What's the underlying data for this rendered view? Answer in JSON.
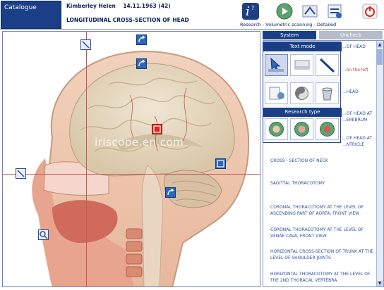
{
  "header": {
    "catalogue_label": "Catalogue",
    "patient_name": "Kimberley Helen",
    "patient_birthdate": "14.11.1963 (42)",
    "view_title": "LONGITUDINAL CROSS-SECTION OF HEAD",
    "status": "Research - Volumetric scanning - Detailed"
  },
  "toolbar_icons": [
    "info-icon",
    "play-icon",
    "scan-icon",
    "document-icon",
    "power-icon"
  ],
  "image": {
    "watermark": "irlscope.en.com"
  },
  "sidebar": {
    "tabs": [
      {
        "label": "System",
        "active": true
      },
      {
        "label": "Uncheck",
        "active": false
      }
    ],
    "list_items": [
      {
        "text": "...OF HEAD",
        "color": "blue"
      },
      {
        "text": "...on the left",
        "color": "red"
      },
      {
        "text": "...HEAD",
        "color": "blue"
      },
      {
        "text": "...OF HEAD AT ...EREBRUM",
        "color": "blue"
      },
      {
        "text": "...OF HEAD AT ...NTRICLE",
        "color": "blue"
      },
      {
        "text": "CROSS - SECTION OF NECK",
        "color": "blue"
      },
      {
        "text": "SAGITTAL THORACOTOMY",
        "color": "blue"
      },
      {
        "text": "CORONAL THORACOTOMY AT THE LEVEL OF ASCENDING PART OF AORTA, FRONT VIEW",
        "color": "blue"
      },
      {
        "text": "CORONAL THORACOTOMY AT THE LEVEL OF VENAE CAVA, FRONT VIEW",
        "color": "blue"
      },
      {
        "text": "HORIZONTAL CROSS-SECTION OF TRUNK AT THE LEVEL OF SHOULDER JOINTS",
        "color": "blue"
      },
      {
        "text": "HORIZONTAL THORACOTOMY AT THE LEVEL OF THE 2ND THORACAL VERTEBRA",
        "color": "blue"
      }
    ]
  },
  "popup": {
    "tools_header": "Text mode",
    "research_header": "Research type",
    "tools": [
      "cursor-icon",
      "eraser-icon",
      "pen-icon",
      "notes-icon",
      "yin-yang-icon",
      "bucket-icon"
    ],
    "research": [
      "research-icon-1",
      "research-icon-2",
      "research-icon-3"
    ]
  },
  "colors": {
    "navy": "#1a3f86",
    "accent_red": "#d42b20",
    "link_blue": "#2b4fa3"
  }
}
